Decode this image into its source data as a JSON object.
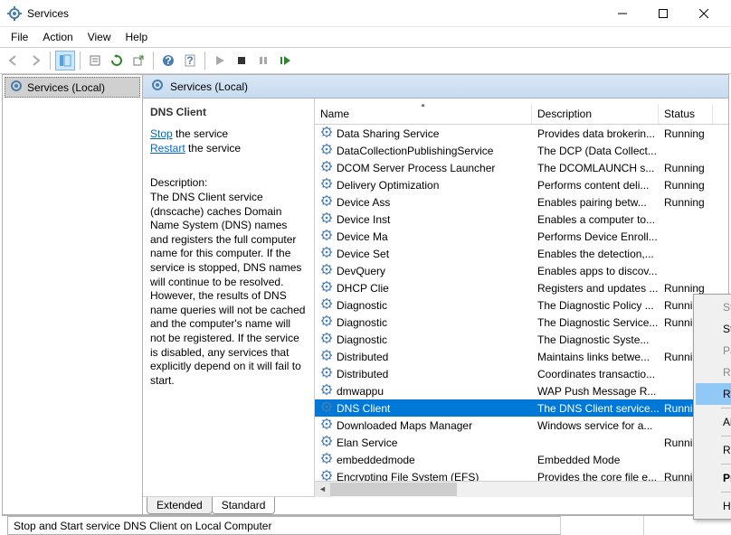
{
  "window": {
    "title": "Services"
  },
  "menu": {
    "file": "File",
    "action": "Action",
    "view": "View",
    "help": "Help"
  },
  "tree": {
    "root": "Services (Local)"
  },
  "right_header": {
    "title": "Services (Local)"
  },
  "detail": {
    "selected": "DNS Client",
    "stop_link": "Stop",
    "stop_suffix": " the service",
    "restart_link": "Restart",
    "restart_suffix": " the service",
    "desc_label": "Description:",
    "desc_text": "The DNS Client service (dnscache) caches Domain Name System (DNS) names and registers the full computer name for this computer. If the service is stopped, DNS names will continue to be resolved. However, the results of DNS name queries will not be cached and the computer's name will not be registered. If the service is disabled, any services that explicitly depend on it will fail to start."
  },
  "columns": {
    "name": "Name",
    "description": "Description",
    "status": "Status"
  },
  "services": [
    {
      "name": "Data Sharing Service",
      "desc": "Provides data brokerin...",
      "status": "Running"
    },
    {
      "name": "DataCollectionPublishingService",
      "desc": "The DCP (Data Collect...",
      "status": ""
    },
    {
      "name": "DCOM Server Process Launcher",
      "desc": "The DCOMLAUNCH s...",
      "status": "Running"
    },
    {
      "name": "Delivery Optimization",
      "desc": "Performs content deli...",
      "status": "Running"
    },
    {
      "name": "Device Ass",
      "desc": "Enables pairing betw...",
      "status": "Running"
    },
    {
      "name": "Device Inst",
      "desc": "Enables a computer to...",
      "status": ""
    },
    {
      "name": "Device Ma",
      "desc": "Performs Device Enroll...",
      "status": ""
    },
    {
      "name": "Device Set",
      "desc": "Enables the detection,...",
      "status": ""
    },
    {
      "name": "DevQuery",
      "desc": "Enables apps to discov...",
      "status": ""
    },
    {
      "name": "DHCP Clie",
      "desc": "Registers and updates ...",
      "status": "Running"
    },
    {
      "name": "Diagnostic",
      "desc": "The Diagnostic Policy ...",
      "status": "Running"
    },
    {
      "name": "Diagnostic",
      "desc": "The Diagnostic Service...",
      "status": "Running"
    },
    {
      "name": "Diagnostic",
      "desc": "The Diagnostic Syste...",
      "status": ""
    },
    {
      "name": "Distributed",
      "desc": "Maintains links betwe...",
      "status": "Running"
    },
    {
      "name": "Distributed",
      "desc": "Coordinates transactio...",
      "status": ""
    },
    {
      "name": "dmwappu",
      "desc": "WAP Push Message R...",
      "status": ""
    },
    {
      "name": "DNS Client",
      "desc": "The DNS Client service...",
      "status": "Running",
      "selected": true
    },
    {
      "name": "Downloaded Maps Manager",
      "desc": "Windows service for a...",
      "status": ""
    },
    {
      "name": "Elan Service",
      "desc": "",
      "status": "Running"
    },
    {
      "name": "embeddedmode",
      "desc": "Embedded Mode",
      "status": ""
    },
    {
      "name": "Encrypting File System (EFS)",
      "desc": "Provides the core file e...",
      "status": "Running"
    }
  ],
  "context_menu": {
    "start": "Start",
    "stop": "Stop",
    "pause": "Pause",
    "resume": "Resume",
    "restart": "Restart",
    "all_tasks": "All Tasks",
    "refresh": "Refresh",
    "properties": "Properties",
    "help": "Help"
  },
  "tabs": {
    "extended": "Extended",
    "standard": "Standard"
  },
  "statusbar": {
    "text": "Stop and Start service DNS Client on Local Computer"
  }
}
